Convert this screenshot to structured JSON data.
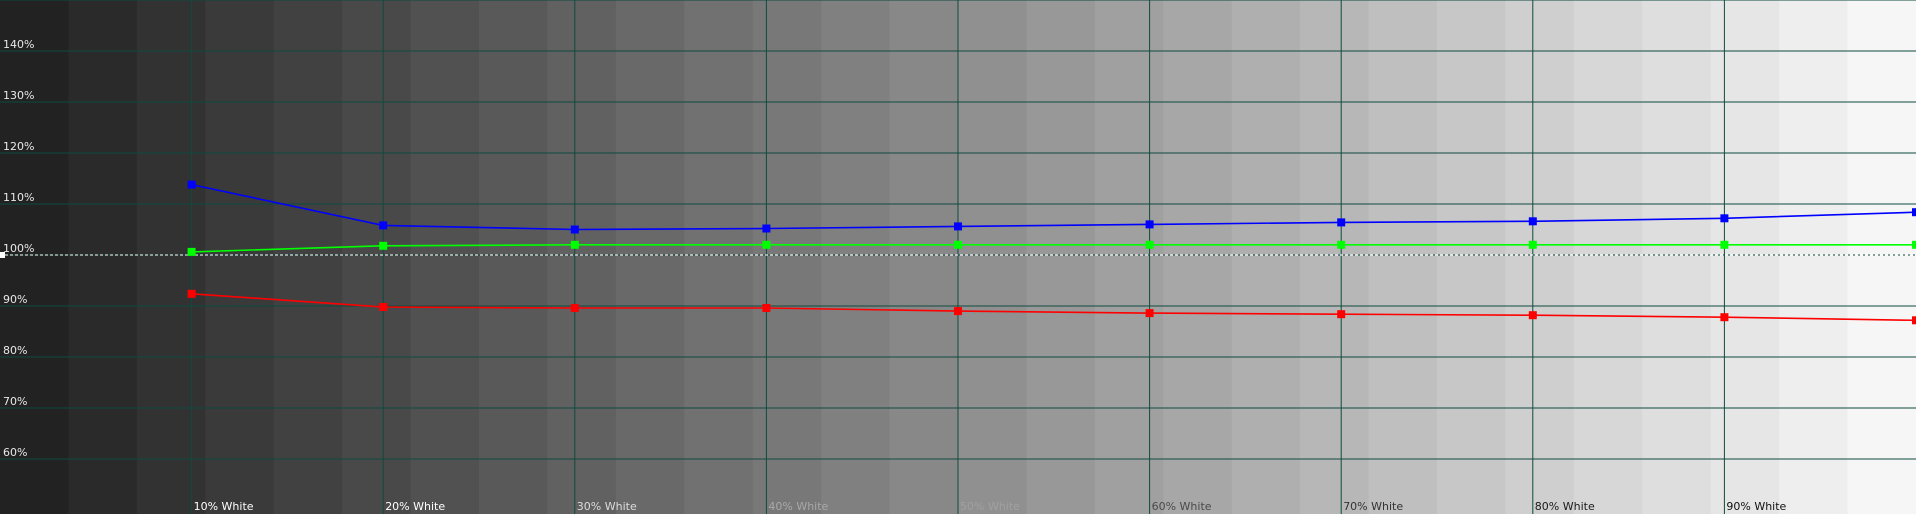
{
  "chart_data": {
    "type": "line",
    "title": "",
    "xlabel": "",
    "ylabel": "",
    "x_tick_labels": [
      "10% White",
      "20% White",
      "30% White",
      "40% White",
      "50% White",
      "60% White",
      "70% White",
      "80% White",
      "90% White"
    ],
    "x": [
      10,
      20,
      30,
      40,
      50,
      60,
      70,
      80,
      90,
      100
    ],
    "xlim": [
      0,
      100
    ],
    "y_tick_labels": [
      "60%",
      "70%",
      "80%",
      "90%",
      "100%",
      "110%",
      "120%",
      "130%",
      "140%"
    ],
    "y_ticks": [
      60,
      70,
      80,
      90,
      100,
      110,
      120,
      130,
      140
    ],
    "ylim": [
      50,
      150
    ],
    "reference_line": 100,
    "grid": true,
    "background": "grayscale step ramp, dark to light",
    "series": [
      {
        "color": "#0000ff",
        "values": [
          113.8,
          105.8,
          105.0,
          105.2,
          105.6,
          106.0,
          106.4,
          106.6,
          107.2,
          108.4
        ]
      },
      {
        "color": "#00ff00",
        "values": [
          100.6,
          101.8,
          102.0,
          102.0,
          102.0,
          102.0,
          102.0,
          102.0,
          102.0,
          102.0
        ]
      },
      {
        "color": "#ff0000",
        "values": [
          92.4,
          89.8,
          89.6,
          89.6,
          89.0,
          88.6,
          88.4,
          88.2,
          87.8,
          87.2
        ]
      }
    ]
  }
}
